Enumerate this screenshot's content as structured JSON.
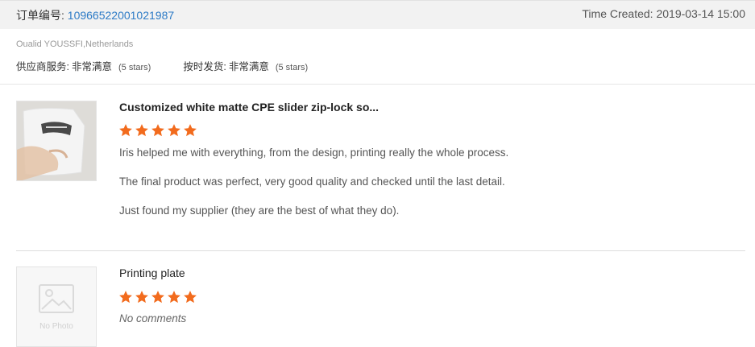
{
  "order": {
    "label": "订单编号: ",
    "number": "10966522001021987",
    "time_created": "Time Created: 2019-03-14 15:00"
  },
  "buyer": "Oualid YOUSSFI,Netherlands",
  "ratings": [
    {
      "label": "供应商服务:",
      "value": "非常满意",
      "stars": "(5 stars)"
    },
    {
      "label": "按时发货:",
      "value": "非常满意",
      "stars": "(5 stars)"
    }
  ],
  "reviews": [
    {
      "title": "Customized white matte CPE slider zip-lock so...",
      "rating": 5,
      "lines": [
        "Iris helped me with everything, from the design, printing really the whole process.",
        "The final product was perfect, very good quality and checked until the last detail.",
        "Just found my supplier (they are the best of what they do)."
      ],
      "image": "product-photo"
    },
    {
      "title": "Printing plate",
      "rating": 5,
      "comment": "No comments",
      "image_label": "No Photo"
    }
  ],
  "colors": {
    "star": "#f26b1d",
    "link": "#2d7bc6",
    "header_bg": "#f2f2f2"
  }
}
